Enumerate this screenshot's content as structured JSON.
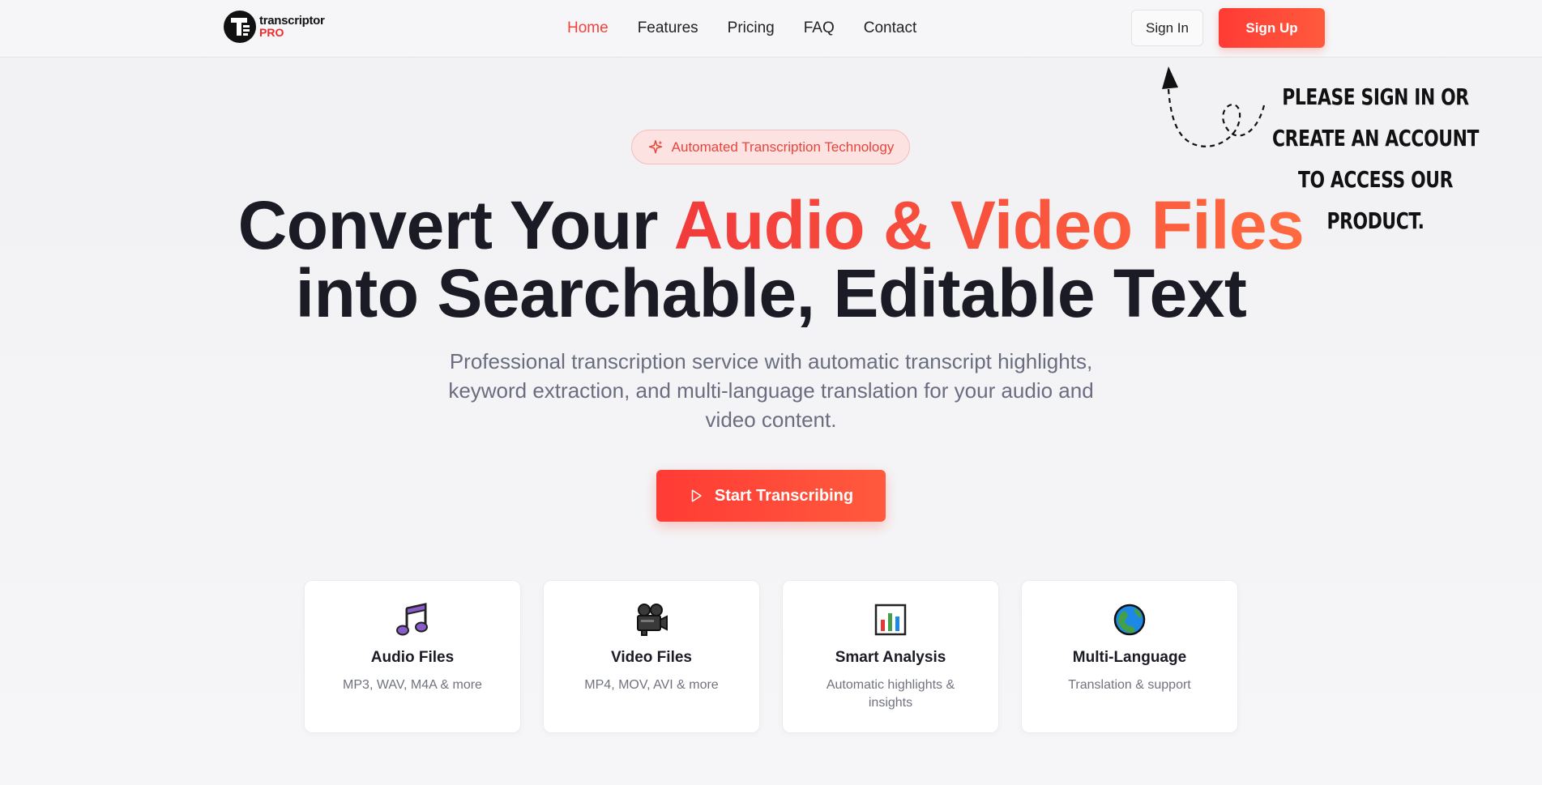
{
  "brand": {
    "name": "transcriptor",
    "sub": "PRO"
  },
  "nav": [
    {
      "label": "Home",
      "active": true
    },
    {
      "label": "Features",
      "active": false
    },
    {
      "label": "Pricing",
      "active": false
    },
    {
      "label": "FAQ",
      "active": false
    },
    {
      "label": "Contact",
      "active": false
    }
  ],
  "auth": {
    "signin": "Sign In",
    "signup": "Sign Up"
  },
  "annotation": "PLEASE SIGN IN OR CREATE AN ACCOUNT TO ACCESS OUR PRODUCT.",
  "hero": {
    "badge": "Automated Transcription Technology",
    "headline_part1": "Convert Your ",
    "headline_accent": "Audio & Video Files",
    "headline_part2": "into Searchable, Editable Text",
    "subtitle": "Professional transcription service with automatic transcript highlights, keyword extraction, and multi-language translation for your audio and video content.",
    "cta": "Start Transcribing"
  },
  "features": [
    {
      "title": "Audio Files",
      "desc": "MP3, WAV, M4A & more",
      "icon": "music-note-icon"
    },
    {
      "title": "Video Files",
      "desc": "MP4, MOV, AVI & more",
      "icon": "movie-camera-icon"
    },
    {
      "title": "Smart Analysis",
      "desc": "Automatic highlights & insights",
      "icon": "bar-chart-icon"
    },
    {
      "title": "Multi-Language",
      "desc": "Translation & support",
      "icon": "globe-icon"
    }
  ],
  "colors": {
    "accent": "#f0443a",
    "accent_end": "#ff6a40",
    "text": "#1a1b25",
    "muted": "#6a6d80"
  }
}
